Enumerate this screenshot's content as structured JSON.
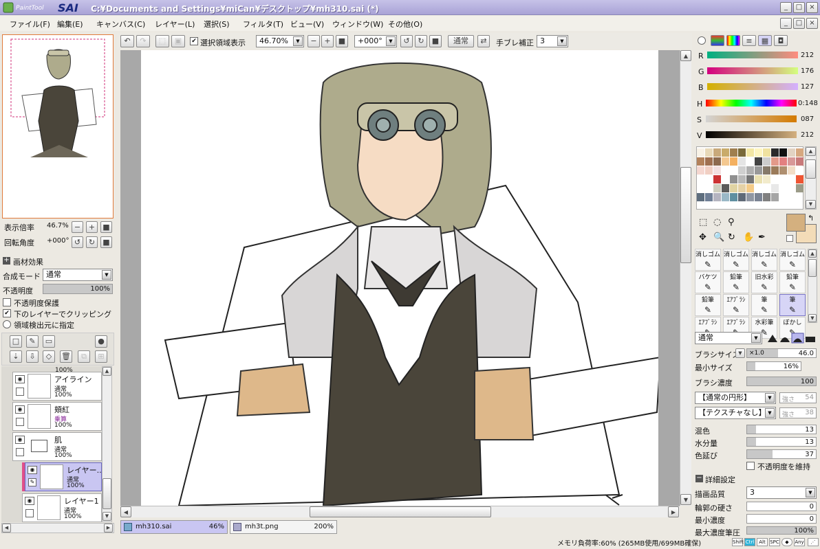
{
  "window": {
    "title": "C:¥Documents and Settings¥miCan¥デスクトップ¥mh310.sai (*)",
    "logo": "PaintTool SAI"
  },
  "menu": [
    {
      "label": "ファイル(F)"
    },
    {
      "label": "編集(E)"
    },
    {
      "label": "キャンバス(C)"
    },
    {
      "label": "レイヤー(L)"
    },
    {
      "label": "選択(S)"
    },
    {
      "label": "フィルタ(T)"
    },
    {
      "label": "ビュー(V)"
    },
    {
      "label": "ウィンドウ(W)"
    },
    {
      "label": "その他(O)"
    }
  ],
  "toolbar": {
    "select_display": "選択領域表示",
    "zoom": "46.70%",
    "angle": "+000°",
    "blend": "通常",
    "stabilizer_label": "手ブレ補正",
    "stabilizer": "3"
  },
  "navigator": {
    "zoom_label": "表示倍率",
    "zoom": "46.7%",
    "rotate_label": "回転角度",
    "rotate": "+000°"
  },
  "layer_panel": {
    "effects": "画材効果",
    "blend_label": "合成モード",
    "blend": "通常",
    "opacity_label": "不透明度",
    "opacity": "100%",
    "opacity_value": 100,
    "protect_opacity": "不透明度保護",
    "clip": "下のレイヤーでクリッピング",
    "clip_checked": true,
    "selection_source": "領域検出元に指定"
  },
  "layers": [
    {
      "name": "アイライン",
      "mode": "通常",
      "opacity": "100%"
    },
    {
      "name": "頬紅",
      "mode": "乗算",
      "opacity": "100%"
    },
    {
      "name": "肌",
      "mode": "通常",
      "opacity": "100%"
    },
    {
      "name": "レイヤー...",
      "mode": "通常",
      "opacity": "100%"
    },
    {
      "name": "レイヤー1",
      "mode": "通常",
      "opacity": "100%"
    }
  ],
  "top_partial_opacity": "100%",
  "color": {
    "R": {
      "label": "R",
      "value": "212"
    },
    "G": {
      "label": "G",
      "value": "176"
    },
    "B": {
      "label": "B",
      "value": "127"
    },
    "H": {
      "label": "H",
      "value": "0:148"
    },
    "S": {
      "label": "S",
      "value": "087"
    },
    "V": {
      "label": "V",
      "value": "212"
    },
    "fg": "#d4b07f",
    "bg": "#f3dcb8"
  },
  "swatches": [
    "#f8f2e6",
    "#e8d9b8",
    "#c9a97a",
    "#c9ab6a",
    "#a07f4f",
    "#7a6a3a",
    "#f3e7a4",
    "#fef5c0",
    "#f0e2a0",
    "#2b2b2b",
    "#111111",
    "#e2d3c3",
    "#d6a880",
    "#b3815a",
    "#a07050",
    "#8d6a4e",
    "#f4c890",
    "#f4b060",
    "#e5e5e5",
    "#ffffff",
    "#444444",
    "#cccccc",
    "#e39a8a",
    "#e38080",
    "#d89898",
    "#c87a7a",
    "#f5d7d0",
    "#f1cfc3",
    "#f3e0e0",
    "#ffffff",
    "#ffffff",
    "#cfcfcf",
    "#b0b0b0",
    "#999999",
    "#867a6a",
    "#9b7b5a",
    "#af8f6f",
    "#f2ddc6",
    "#ffffff",
    "#ffffff",
    "#ffffff",
    "#cc3333",
    "#ffffff",
    "#909090",
    "#b8b8b8",
    "#757575",
    "#eae1b1",
    "#f2ebcc",
    "#ffffff",
    "#ffffff",
    "#ffffff",
    "#ee5533",
    "#ffffff",
    "#ffffff",
    "#cfcfbf",
    "#5b5b5b",
    "#e0d3a3",
    "#e5d1a6",
    "#f4cb88",
    "#ffffff",
    "#ffffff",
    "#e8e8e8",
    "#ffffff",
    "#ffffff",
    "#9b9b88",
    "#5e6e7e",
    "#6f7f96",
    "#b4b4c0",
    "#9ab8c7",
    "#5f8fa0",
    "#606a77",
    "#9097a3",
    "#7b8494",
    "#808080",
    "#a5a5a5"
  ],
  "tools": [
    {
      "label": "消しゴム"
    },
    {
      "label": "消しゴム"
    },
    {
      "label": "消しゴム"
    },
    {
      "label": "消しゴム"
    },
    {
      "label": "バケツ"
    },
    {
      "label": "鉛筆"
    },
    {
      "label": "旧水彩"
    },
    {
      "label": "鉛筆"
    },
    {
      "label": "鉛筆"
    },
    {
      "label": "ｴｱﾌﾞﾗｼ"
    },
    {
      "label": "筆"
    },
    {
      "label": "筆"
    },
    {
      "label": "ｴｱﾌﾞﾗｼ"
    },
    {
      "label": "ｴｱﾌﾞﾗｼ"
    },
    {
      "label": "水彩筆"
    },
    {
      "label": "ぼかし"
    }
  ],
  "brush": {
    "mode": "通常",
    "size_label": "ブラシサイズ",
    "size_mult": "×1.0",
    "size": "46.0",
    "min_label": "最小サイズ",
    "min": "16%",
    "density_label": "ブラシ濃度",
    "density": "100",
    "shape": "【通常の円形】",
    "shape_strength_label": "強さ",
    "shape_strength": "54",
    "texture": "【テクスチャなし】",
    "texture_strength_label": "強さ",
    "texture_strength": "38",
    "mix_label": "混色",
    "mix": "13",
    "water_label": "水分量",
    "water": "13",
    "stretch_label": "色延び",
    "stretch": "37",
    "keep_opacity": "不透明度を維持",
    "detail": "詳細設定",
    "quality_label": "描画品質",
    "quality": "3",
    "hardness_label": "輪郭の硬さ",
    "hardness": "0",
    "min_density_label": "最小濃度",
    "min_density": "0",
    "max_pressure_label": "最大濃度筆圧",
    "max_pressure": "100%"
  },
  "tabs": [
    {
      "name": "mh310.sai",
      "zoom": "46%"
    },
    {
      "name": "mh3t.png",
      "zoom": "200%"
    }
  ],
  "status": {
    "memory": "メモリ負荷率:60% (265MB使用/699MB確保)",
    "keys": [
      "Shift",
      "Ctrl",
      "Alt",
      "SPC",
      "Any"
    ]
  }
}
